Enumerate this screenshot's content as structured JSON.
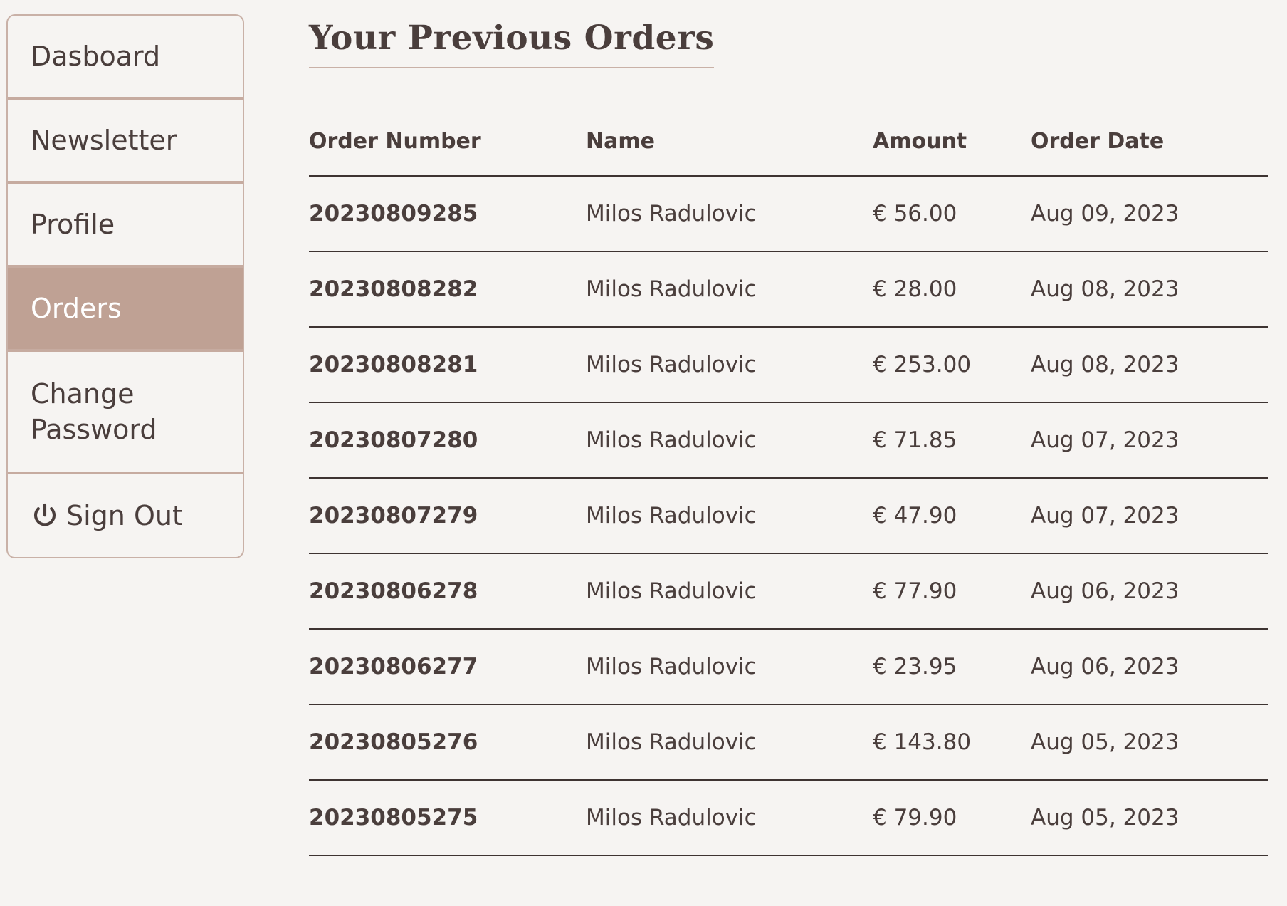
{
  "sidebar": {
    "items": [
      {
        "label": "Dasboard"
      },
      {
        "label": "Newsletter"
      },
      {
        "label": "Profile"
      },
      {
        "label": "Orders",
        "active": true
      },
      {
        "label": "Change Password"
      },
      {
        "label": "Sign Out",
        "icon": "power-icon"
      }
    ]
  },
  "main": {
    "title": "Your Previous Orders",
    "table": {
      "headers": [
        "Order Number",
        "Name",
        "Amount",
        "Order Date"
      ],
      "rows": [
        {
          "order_number": "20230809285",
          "name": "Milos Radulovic",
          "amount": "€ 56.00",
          "date": "Aug 09, 2023"
        },
        {
          "order_number": "20230808282",
          "name": "Milos Radulovic",
          "amount": "€ 28.00",
          "date": "Aug 08, 2023"
        },
        {
          "order_number": "20230808281",
          "name": "Milos Radulovic",
          "amount": "€ 253.00",
          "date": "Aug 08, 2023"
        },
        {
          "order_number": "20230807280",
          "name": "Milos Radulovic",
          "amount": "€ 71.85",
          "date": "Aug 07, 2023"
        },
        {
          "order_number": "20230807279",
          "name": "Milos Radulovic",
          "amount": "€ 47.90",
          "date": "Aug 07, 2023"
        },
        {
          "order_number": "20230806278",
          "name": "Milos Radulovic",
          "amount": "€ 77.90",
          "date": "Aug 06, 2023"
        },
        {
          "order_number": "20230806277",
          "name": "Milos Radulovic",
          "amount": "€ 23.95",
          "date": "Aug 06, 2023"
        },
        {
          "order_number": "20230805276",
          "name": "Milos Radulovic",
          "amount": "€ 143.80",
          "date": "Aug 05, 2023"
        },
        {
          "order_number": "20230805275",
          "name": "Milos Radulovic",
          "amount": "€ 79.90",
          "date": "Aug 05, 2023"
        }
      ]
    }
  },
  "colors": {
    "background": "#f6f4f2",
    "accent": "#bfa194",
    "border": "#c6aba0",
    "text": "#4a3e3c"
  }
}
